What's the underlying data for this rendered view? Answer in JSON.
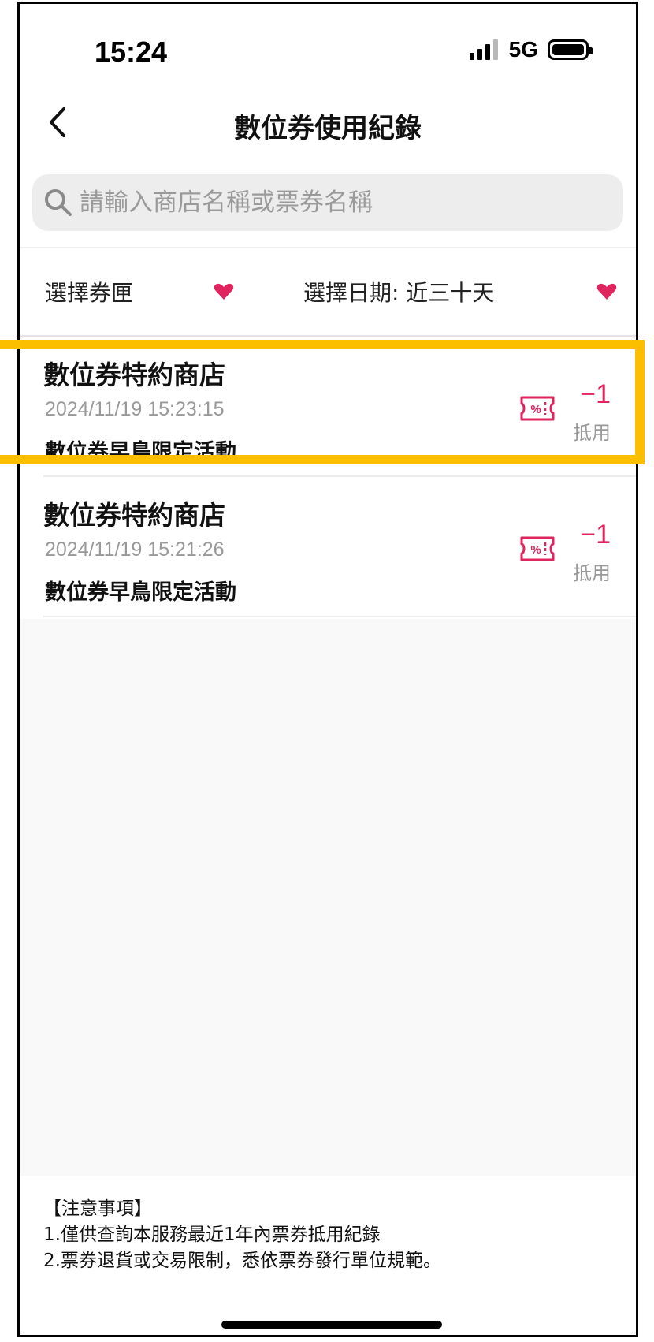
{
  "status_bar": {
    "time": "15:24",
    "network": "5G"
  },
  "header": {
    "title": "數位券使用紀錄"
  },
  "search": {
    "placeholder": "請輸入商店名稱或票券名稱"
  },
  "filters": {
    "wallet_label": "選擇券匣",
    "date_label": "選擇日期: 近三十天"
  },
  "records": [
    {
      "shop": "數位券特約商店",
      "time": "2024/11/19 15:23:15",
      "campaign": "數位券早鳥限定活動",
      "amount": "−1",
      "type": "抵用"
    },
    {
      "shop": "數位券特約商店",
      "time": "2024/11/19 15:21:26",
      "campaign": "數位券早鳥限定活動",
      "amount": "−1",
      "type": "抵用"
    }
  ],
  "notes": {
    "title": "【注意事項】",
    "line1": "1.僅供查詢本服務最近1年內票券抵用紀錄",
    "line2": "2.票券退貨或交易限制，悉依票券發行單位規範。"
  },
  "colors": {
    "accent": "#e0245e",
    "highlight": "#fbbf00"
  }
}
